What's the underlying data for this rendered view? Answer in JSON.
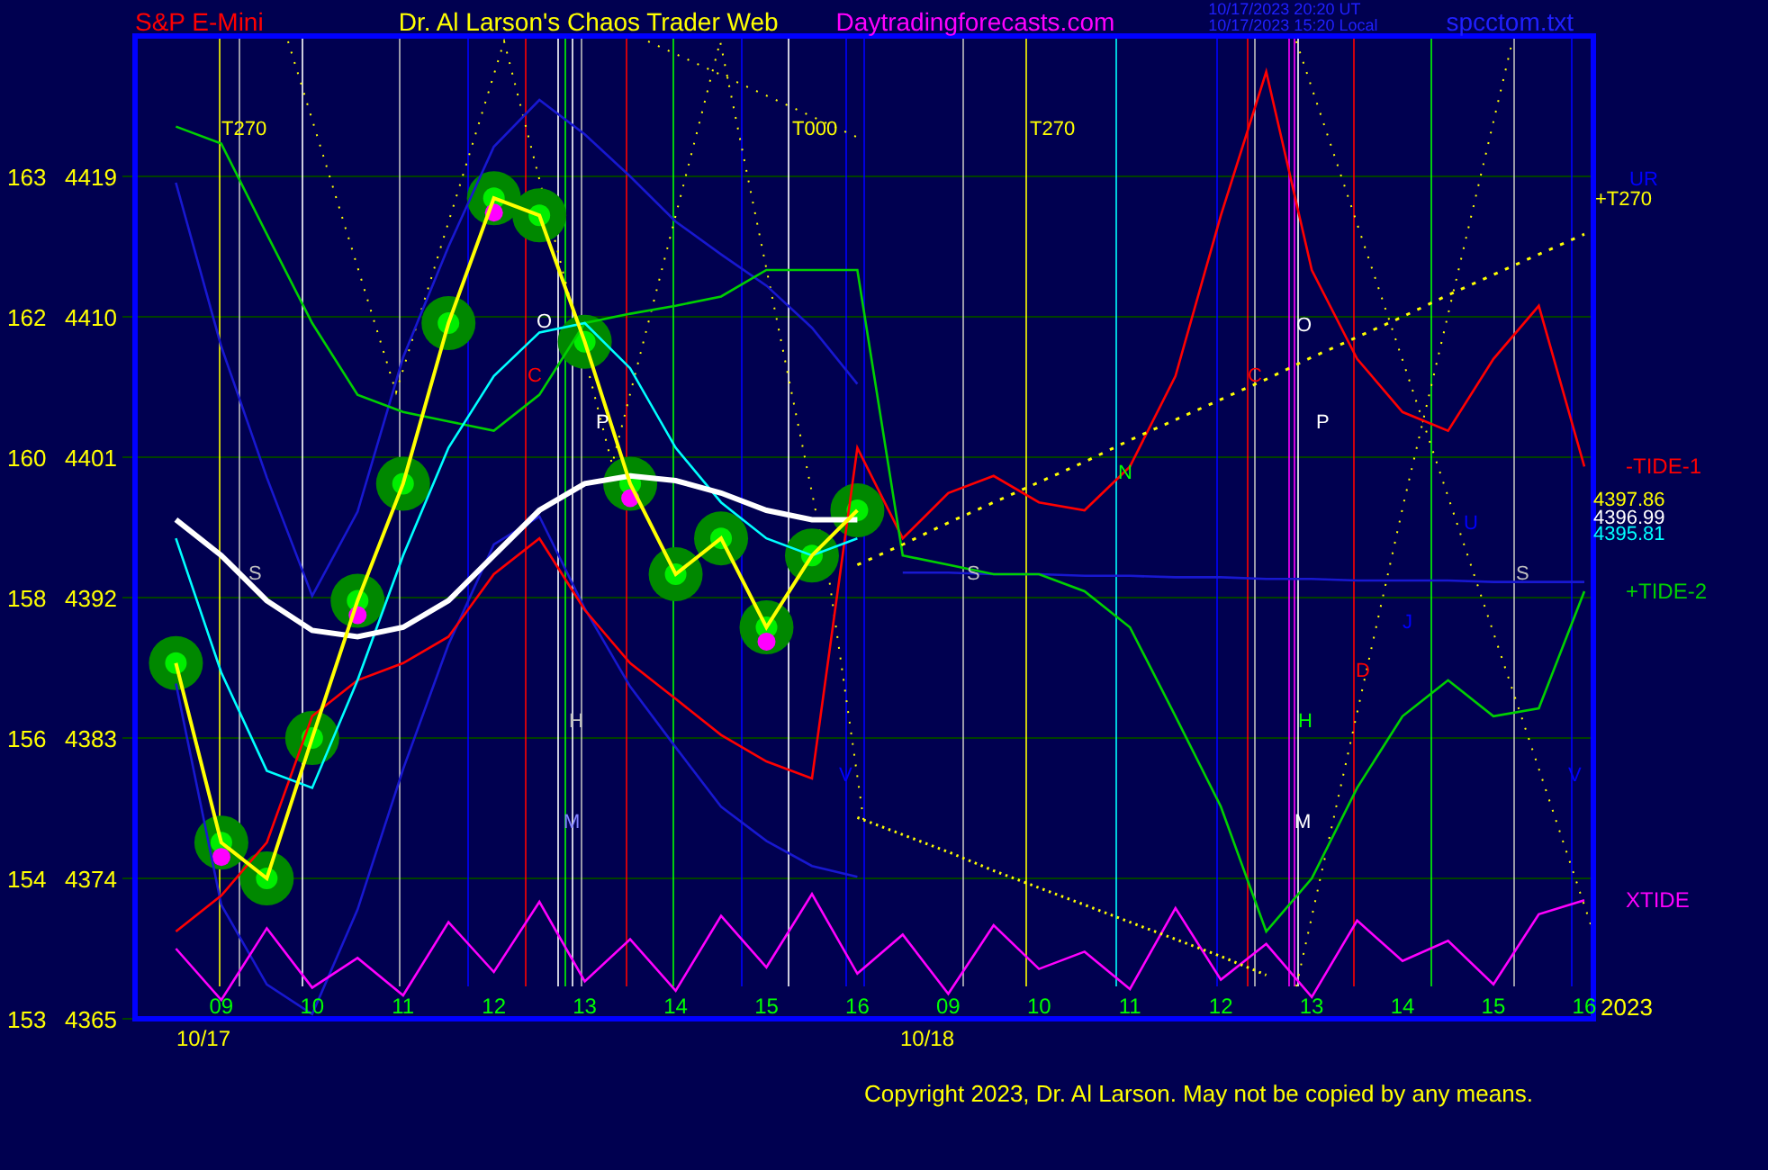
{
  "header": {
    "symbol": "S&P E-Mini",
    "site_title": "Dr. Al Larson's Chaos Trader Web",
    "site": "Daytradingforecasts.com",
    "timestamps": [
      "10/17/2023 20:20 UT",
      "10/17/2023 15:20 Local"
    ],
    "file_name": "spcctom.txt"
  },
  "chart": {
    "chart_data": {
      "type": "line",
      "grid": true,
      "categories": [
        null,
        "09",
        null,
        "10",
        null,
        "11",
        null,
        "12",
        null,
        "13",
        null,
        "14",
        null,
        "15",
        null,
        "16",
        null,
        "09",
        null,
        "10",
        null,
        "11",
        null,
        "12",
        null,
        "13",
        null,
        "14",
        null,
        "15",
        null,
        "16"
      ],
      "series": [
        {
          "color": "#1818d0",
          "values": [
            4418.6,
            4408.1,
            4399.7,
            4392.1,
            4397.5,
            4407.4,
            4414.5,
            4420.9,
            4423.9,
            4421.7,
            4419.0,
            4416.1,
            4414.0,
            4412.0,
            4409.3,
            4405.7,
            null,
            null,
            null,
            null,
            null,
            null,
            null,
            null,
            null,
            null,
            null,
            null,
            null,
            null,
            null,
            null
          ]
        },
        {
          "color": "#1818d0",
          "values": [
            4386.5,
            4372.3,
            4367.2,
            4365.3,
            4372.0,
            4381.0,
            4389.0,
            4395.4,
            4397.2,
            4391.3,
            4386.3,
            4382.4,
            4378.6,
            4376.4,
            4374.8,
            4374.1,
            null,
            null,
            null,
            null,
            null,
            null,
            null,
            null,
            null,
            null,
            null,
            null,
            null,
            null,
            null,
            null
          ]
        },
        {
          "color": "#1818d0",
          "values": [
            null,
            null,
            null,
            null,
            null,
            null,
            null,
            null,
            null,
            null,
            null,
            null,
            null,
            null,
            null,
            null,
            4393.6,
            4393.6,
            4393.5,
            4393.5,
            4393.4,
            4393.4,
            4393.3,
            4393.3,
            4393.2,
            4393.2,
            4393.1,
            4393.1,
            4393.1,
            4393.0,
            4393.0,
            4393.0
          ]
        },
        {
          "color": "#ff0000",
          "name": "-TIDE-1",
          "values": [
            4370.6,
            4372.9,
            4376.3,
            4384.4,
            4386.7,
            4387.8,
            4389.5,
            4393.5,
            4395.8,
            4391.2,
            4387.8,
            4385.5,
            4383.2,
            4381.5,
            4380.4,
            4401.6,
            4395.8,
            4398.7,
            4399.8,
            4398.1,
            4397.6,
            4400.4,
            4406.2,
            4416.5,
            4425.7,
            4413.0,
            4407.3,
            4403.9,
            4402.7,
            4407.3,
            4410.7,
            4400.4
          ]
        },
        {
          "color": "#00d000",
          "name": "+TIDE-2",
          "values": [
            4422.2,
            4421.1,
            4415.3,
            4409.6,
            4405.0,
            4403.9,
            4403.3,
            4402.7,
            4405.0,
            4409.6,
            4410.2,
            4410.7,
            4411.3,
            4413.0,
            4413.0,
            4413.0,
            4394.7,
            4394.1,
            4393.5,
            4393.5,
            4392.4,
            4390.1,
            4384.4,
            4378.6,
            4370.6,
            4374.0,
            4379.8,
            4384.4,
            4386.7,
            4384.4,
            4384.9,
            4392.4
          ]
        },
        {
          "color": "#ff00ff",
          "name": "XTIDE",
          "values": [
            4369.5,
            4366.2,
            4370.8,
            4367.0,
            4368.9,
            4366.5,
            4371.2,
            4368.0,
            4372.5,
            4367.4,
            4370.1,
            4366.8,
            4371.6,
            4368.3,
            4373.0,
            4367.9,
            4370.4,
            4366.6,
            4371.0,
            4368.2,
            4369.3,
            4366.9,
            4372.1,
            4367.5,
            4369.8,
            4366.4,
            4371.3,
            4368.7,
            4370.0,
            4367.2,
            4371.7,
            4372.6
          ]
        },
        {
          "color": "#00ffff",
          "values": [
            4395.8,
            4387.2,
            4380.9,
            4379.8,
            4386.7,
            4394.7,
            4401.6,
            4406.2,
            4409.0,
            4409.6,
            4406.7,
            4401.6,
            4398.1,
            4395.8,
            4394.7,
            4395.8,
            null,
            null,
            null,
            null,
            null,
            null,
            null,
            null,
            null,
            null,
            null,
            null,
            null,
            null,
            null,
            null
          ]
        },
        {
          "color": "#ffffff",
          "values": [
            4397.0,
            4394.7,
            4391.8,
            4389.9,
            4389.5,
            4390.1,
            4391.8,
            4394.7,
            4397.6,
            4399.3,
            4399.8,
            4399.5,
            4398.7,
            4397.6,
            4397.0,
            4397.0,
            null,
            null,
            null,
            null,
            null,
            null,
            null,
            null,
            null,
            null,
            null,
            null,
            null,
            null,
            null,
            null
          ]
        },
        {
          "color": "#ffff00",
          "line_style": "dotted",
          "values": [
            null,
            null,
            null,
            null,
            null,
            null,
            null,
            null,
            null,
            null,
            null,
            null,
            null,
            null,
            null,
            4394.1,
            4395.4,
            4396.8,
            4398.1,
            4399.4,
            4400.7,
            4402.1,
            4403.4,
            4404.7,
            4406.0,
            4407.4,
            4408.7,
            4410.0,
            4411.4,
            4412.7,
            4414.0,
            4415.3
          ]
        },
        {
          "color": "#ffff00",
          "line_style": "dotted",
          "values": [
            null,
            null,
            null,
            null,
            null,
            null,
            null,
            null,
            null,
            null,
            null,
            null,
            null,
            null,
            null,
            4377.9,
            4376.8,
            4375.7,
            4374.5,
            4373.4,
            4372.3,
            4371.2,
            4370.1,
            4369.0,
            4367.8,
            null,
            null,
            null,
            null,
            null,
            null,
            null
          ]
        },
        {
          "color": "#ffff00",
          "marker": "circle",
          "values": [
            4387.8,
            4376.3,
            4374.0,
            4383.0,
            4391.8,
            4399.3,
            4409.6,
            4417.6,
            4416.5,
            4408.4,
            4399.3,
            4393.5,
            4395.8,
            4390.1,
            4394.7,
            4397.6,
            null,
            null,
            null,
            null,
            null,
            null,
            null,
            null,
            null,
            null,
            null,
            null,
            null,
            null,
            null,
            null
          ]
        }
      ],
      "ylim": [
        4365,
        4428
      ],
      "yticks": [
        4419,
        4410,
        4401,
        4392,
        4383,
        4374,
        4365
      ]
    },
    "left_scale": [
      "163",
      "162",
      "160",
      "158",
      "156",
      "154",
      "153"
    ],
    "markers": [
      {
        "text": "T270",
        "color": "#ffff00"
      },
      {
        "text": "T000",
        "color": "#ffff00"
      },
      {
        "text": "T270",
        "color": "#ffff00"
      },
      {
        "text": "UR",
        "color": "#0000ff"
      },
      {
        "text": "+T270",
        "color": "#ffff00"
      },
      {
        "text": "4397.86",
        "color": "#ffff00"
      },
      {
        "text": "4396.99",
        "color": "#ffffff"
      },
      {
        "text": "4395.81",
        "color": "#00ffff"
      },
      {
        "text": "S",
        "color": "#c0c0c0"
      },
      {
        "text": "C",
        "color": "#ff0000"
      },
      {
        "text": "O",
        "color": "#ffffff"
      },
      {
        "text": "P",
        "color": "#ffffff"
      },
      {
        "text": "H",
        "color": "#c0c0c0"
      },
      {
        "text": "M",
        "color": "#8080ff"
      },
      {
        "text": "V",
        "color": "#0000ff"
      },
      {
        "text": "S",
        "color": "#c0c0c0"
      },
      {
        "text": "N",
        "color": "#00ff00"
      },
      {
        "text": "C",
        "color": "#ff0000"
      },
      {
        "text": "O",
        "color": "#ffffff"
      },
      {
        "text": "P",
        "color": "#ffffff"
      },
      {
        "text": "H",
        "color": "#00ff00"
      },
      {
        "text": "M",
        "color": "#ffffff"
      },
      {
        "text": "D",
        "color": "#ff0000"
      },
      {
        "text": "J",
        "color": "#0000ff"
      },
      {
        "text": "U",
        "color": "#0000ff"
      },
      {
        "text": "S",
        "color": "#c0c0c0"
      },
      {
        "text": "V",
        "color": "#0000ff"
      }
    ],
    "dates": [
      "10/17",
      "10/18"
    ],
    "year": "2023"
  },
  "copyright": "Copyright 2023, Dr. Al Larson. May not be copied by any means."
}
